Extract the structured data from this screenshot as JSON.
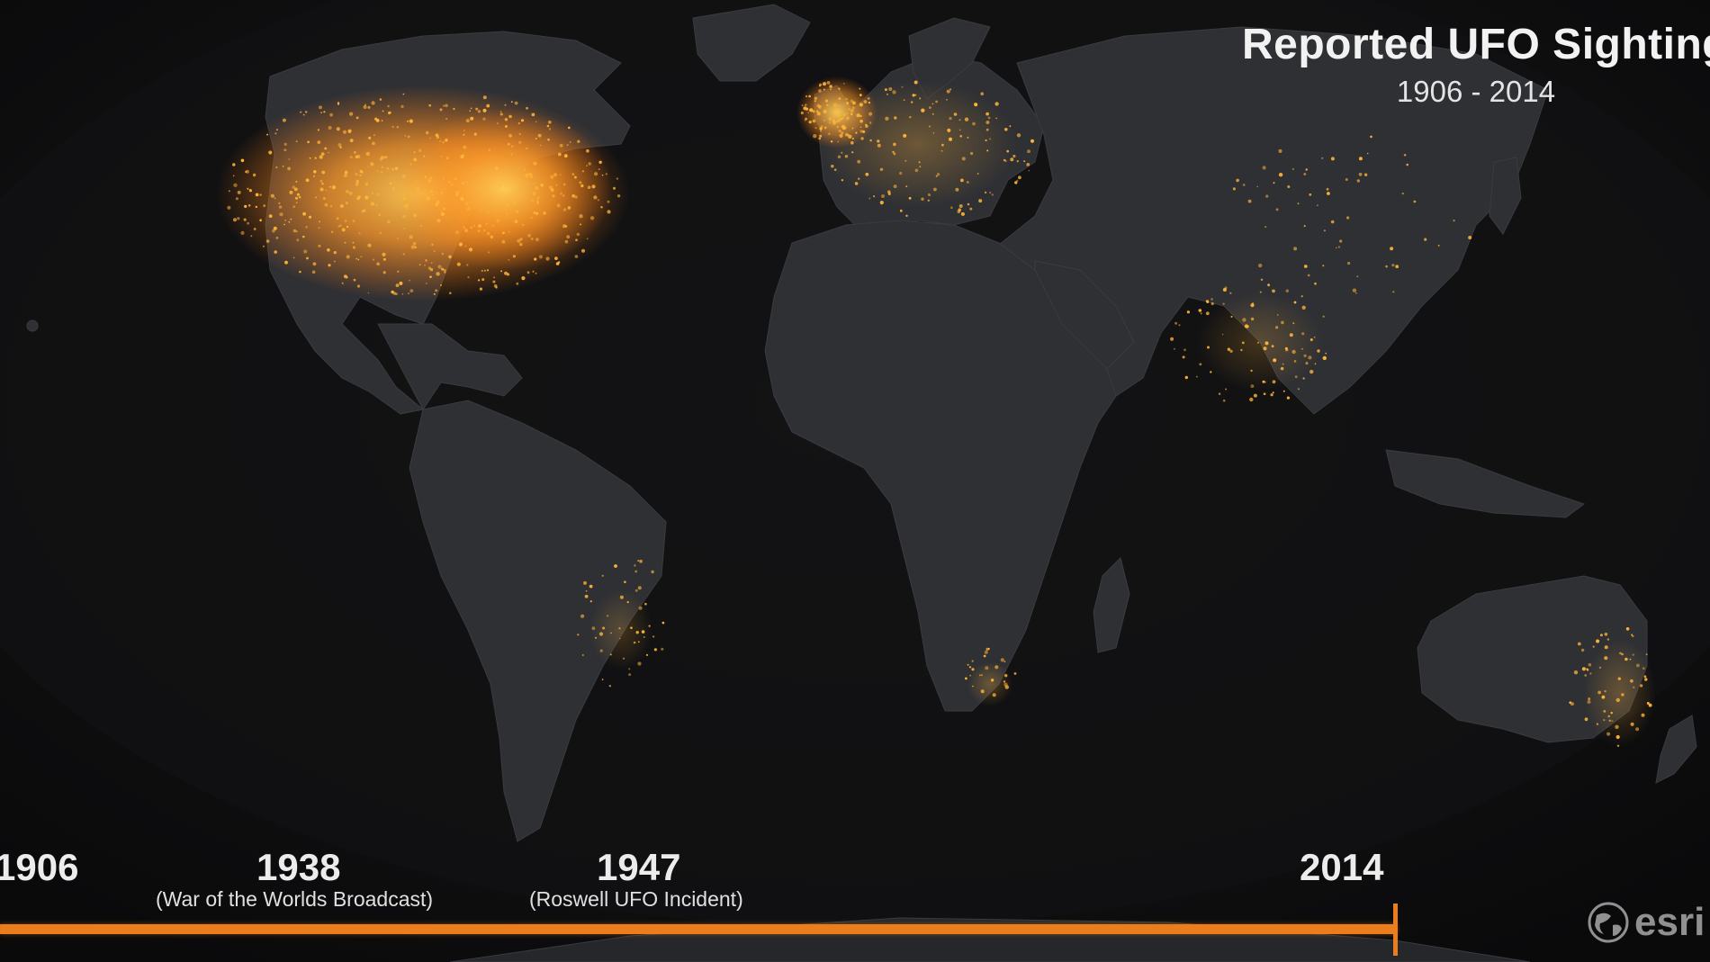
{
  "map": {
    "title": "Reported UFO Sightings",
    "subtitle": "1906 - 2014",
    "basemap": "dark world map",
    "colors": {
      "ocean": "#0f0f11",
      "land": "#2f3034",
      "sighting": "#ffb43a",
      "sighting_hot": "#ffd25a",
      "timeline": "#ea7d1c"
    }
  },
  "timeline": {
    "ticks": [
      {
        "year": "1906",
        "note": ""
      },
      {
        "year": "1938",
        "note": "(War of the Worlds Broadcast)"
      },
      {
        "year": "1947",
        "note": "(Roswell UFO Incident)"
      },
      {
        "year": "2014",
        "note": ""
      }
    ],
    "current_year": "2014",
    "progress": 1.0
  },
  "logo": {
    "text": "esri",
    "icon": "globe-icon"
  }
}
